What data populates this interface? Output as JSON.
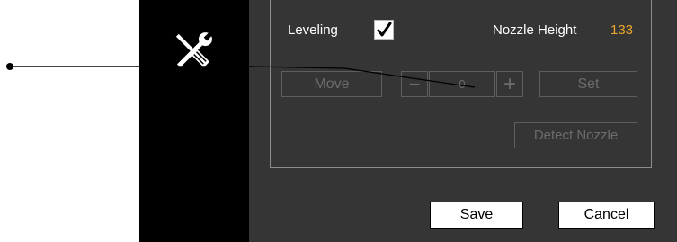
{
  "panel": {
    "leveling_label": "Leveling",
    "leveling_checked": true,
    "nozzle_height_label": "Nozzle Height",
    "nozzle_height_value": "133",
    "move_label": "Move",
    "minus_label": "−",
    "step_value": "0",
    "plus_label": "+",
    "set_label": "Set",
    "detect_nozzle_label": "Detect Nozzle"
  },
  "footer": {
    "save_label": "Save",
    "cancel_label": "Cancel"
  },
  "icons": {
    "sidebar_icon": "tools-icon",
    "checkbox_mark": "checkmark-icon"
  },
  "colors": {
    "panel_bg": "#353535",
    "sidebar_bg": "#000000",
    "value_accent": "#e7a52c"
  }
}
